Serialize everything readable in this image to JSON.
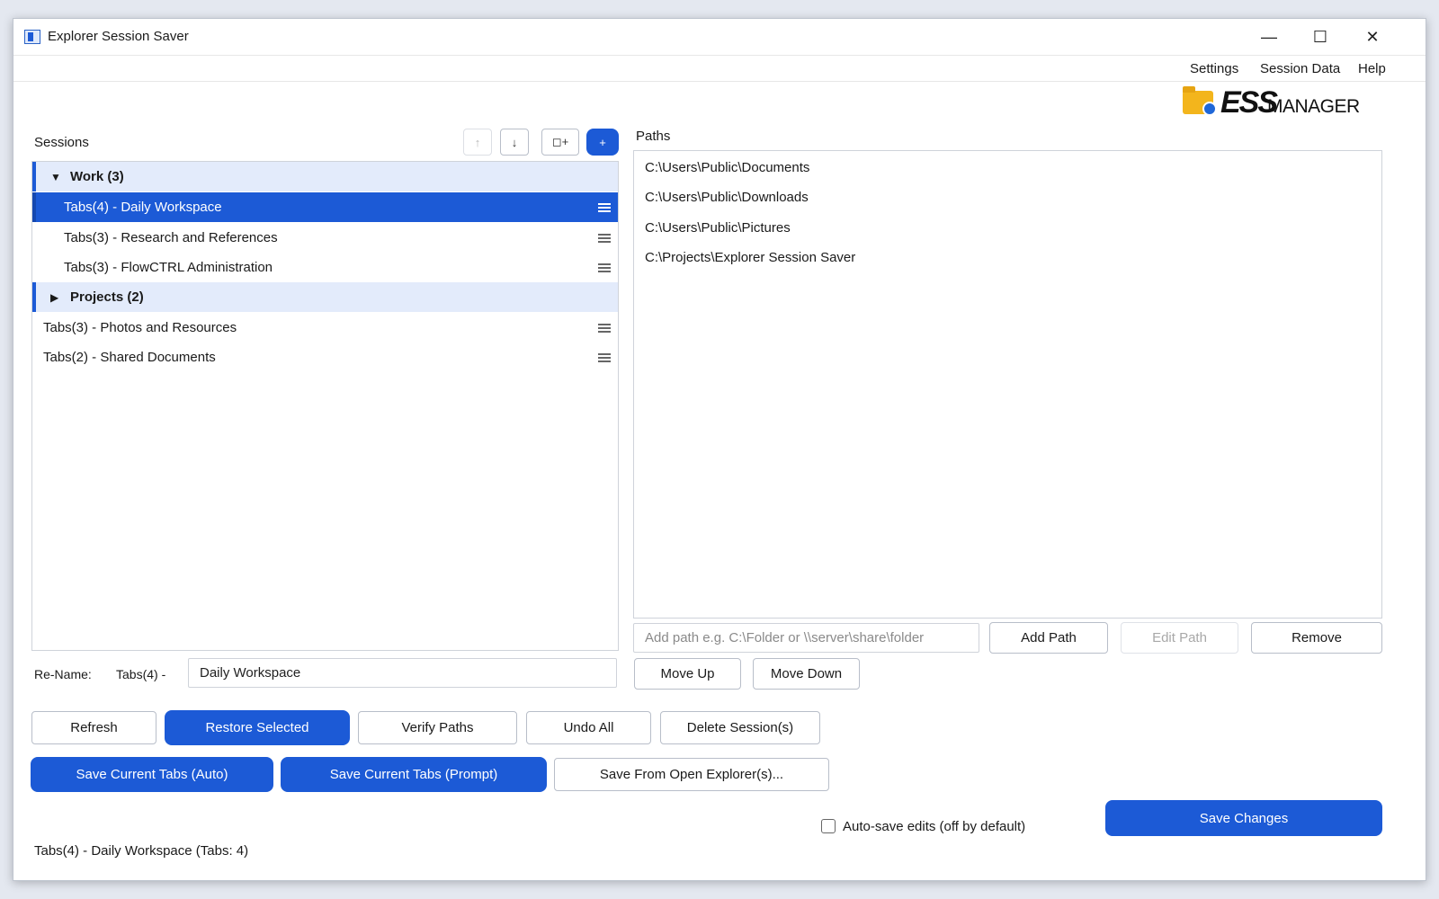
{
  "window": {
    "title": "Explorer Session Saver"
  },
  "window_controls": {
    "minimize": "—",
    "maximize": "☐",
    "close": "✕"
  },
  "menu": {
    "settings": "Settings",
    "session_data": "Session Data",
    "help": "Help"
  },
  "logo": {
    "ess": "ESS",
    "manager": "MANAGER"
  },
  "sessions": {
    "label": "Sessions",
    "toolbar": {
      "up": "↑",
      "down": "↓",
      "add_group": "◻+",
      "add": "+"
    },
    "tree": [
      {
        "type": "group",
        "label": "Work (3)",
        "expanded": true
      },
      {
        "type": "item",
        "label": "Tabs(4) - Daily Workspace",
        "selected": true
      },
      {
        "type": "item",
        "label": "Tabs(3) - Research and References"
      },
      {
        "type": "item",
        "label": "Tabs(3) - FlowCTRL Administration"
      },
      {
        "type": "group",
        "label": "Projects (2)",
        "expanded": false
      },
      {
        "type": "item",
        "label": "Tabs(3) - Photos and Resources"
      },
      {
        "type": "item",
        "label": "Tabs(2) - Shared Documents"
      }
    ]
  },
  "paths": {
    "label": "Paths",
    "items": [
      "C:\\Users\\Public\\Documents",
      "C:\\Users\\Public\\Downloads",
      "C:\\Users\\Public\\Pictures",
      "C:\\Projects\\Explorer Session Saver"
    ],
    "add_placeholder": "Add path e.g. C:\\Folder or \\\\server\\share\\folder",
    "add_path": "Add Path",
    "edit_path": "Edit Path",
    "remove": "Remove",
    "move_up": "Move Up",
    "move_down": "Move Down"
  },
  "rename": {
    "label": "Re-Name:",
    "prefix": "Tabs(4) -",
    "value": "Daily Workspace"
  },
  "actions": {
    "refresh": "Refresh",
    "restore_selected": "Restore Selected",
    "verify_paths": "Verify Paths",
    "undo_all": "Undo All",
    "delete_sessions": "Delete Session(s)",
    "save_auto": "Save Current Tabs (Auto)",
    "save_prompt": "Save Current Tabs (Prompt)",
    "save_from_explorer": "Save From Open Explorer(s)...",
    "save_changes": "Save Changes"
  },
  "autosave": {
    "label": "Auto-save edits (off by default)",
    "checked": false
  },
  "status": {
    "text": "Tabs(4) - Daily Workspace  (Tabs: 4)"
  },
  "colors": {
    "accent": "#1c5ad6",
    "group_bg": "#e3ebfb"
  }
}
